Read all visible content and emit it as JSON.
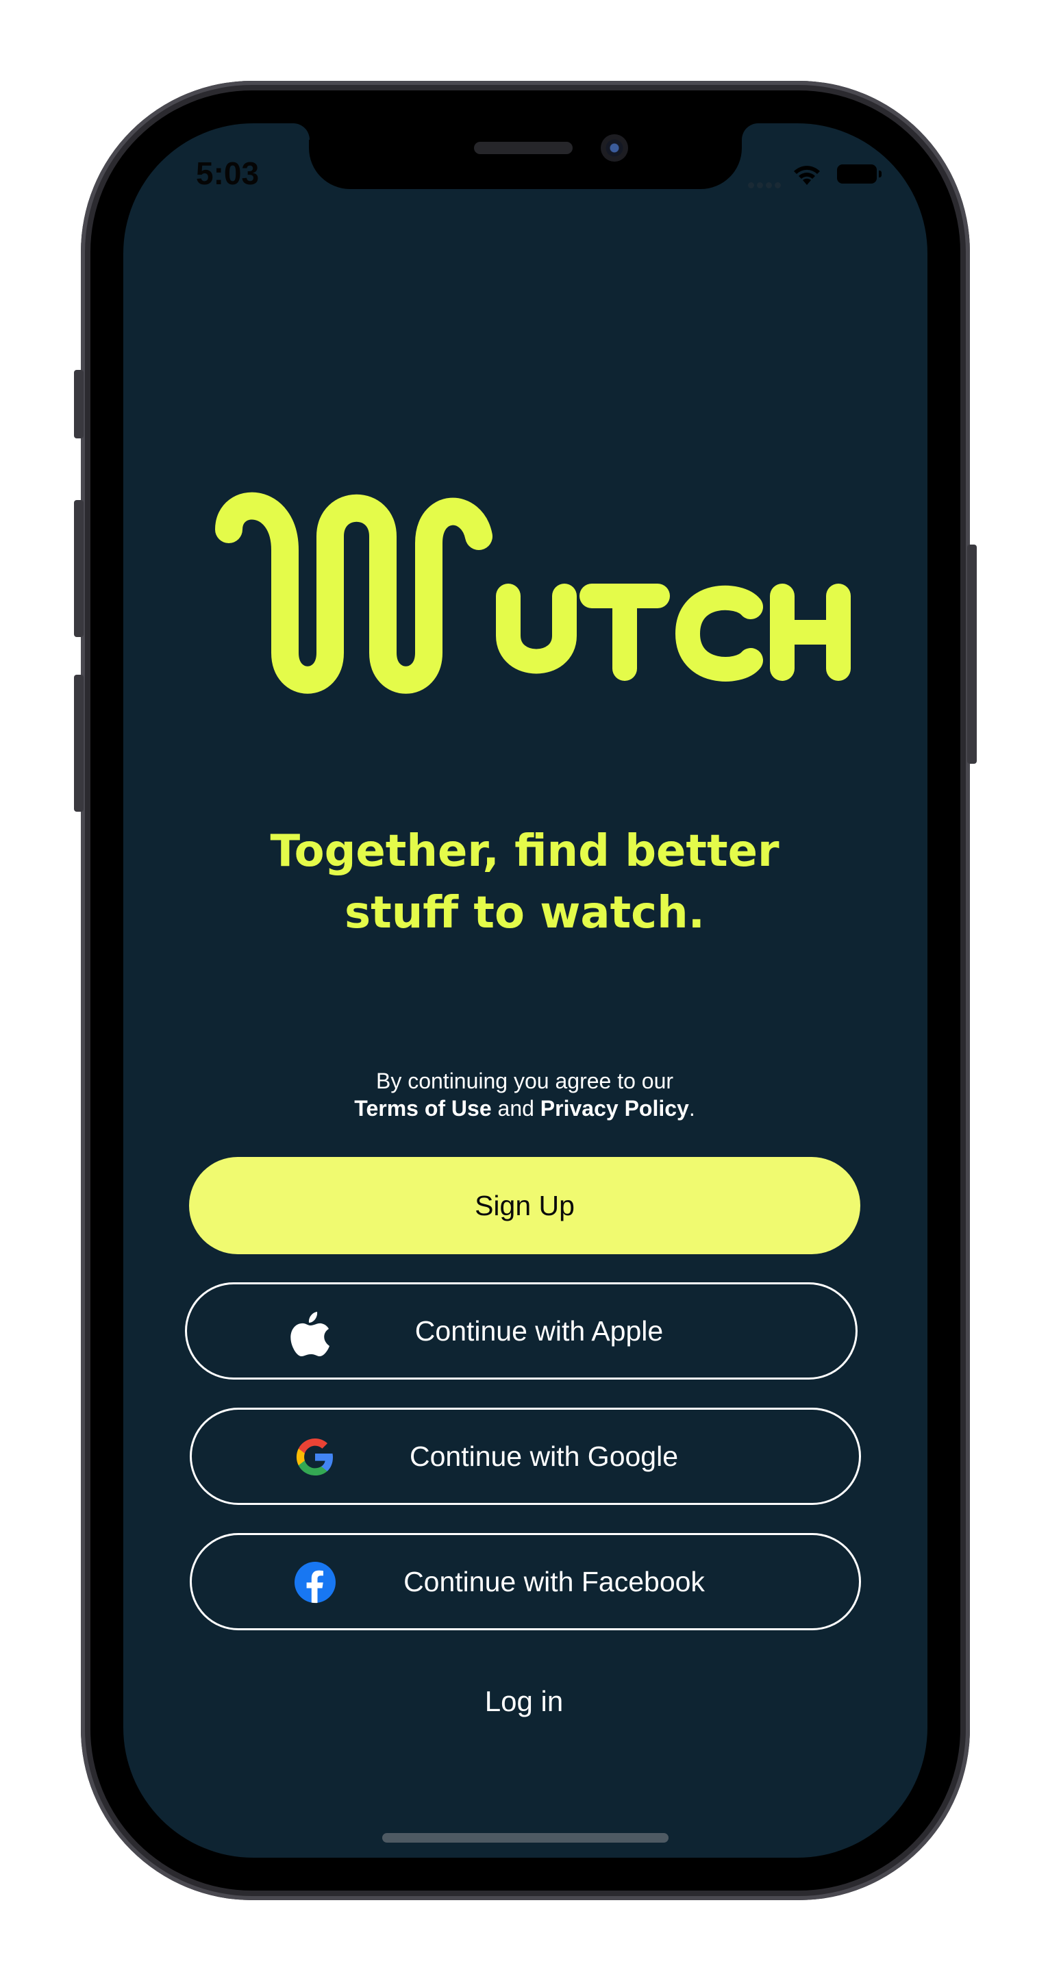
{
  "status_bar": {
    "time": "5:03"
  },
  "brand": {
    "logo_text": "Wutch",
    "accent_color": "#e4fb4a",
    "background_color": "#0e2432"
  },
  "tagline": {
    "line1": "Together, find better",
    "line2": "stuff to watch."
  },
  "legal": {
    "line1": "By continuing you agree to our",
    "terms": "Terms of Use",
    "and": "and",
    "privacy": "Privacy Policy",
    "end": "."
  },
  "buttons": {
    "signup": "Sign Up",
    "apple": "Continue with Apple",
    "google": "Continue with Google",
    "facebook": "Continue with Facebook",
    "login": "Log in"
  },
  "icons": {
    "apple": "apple-icon",
    "google": "google-icon",
    "facebook": "facebook-icon",
    "wifi": "wifi-icon",
    "battery": "battery-icon"
  }
}
